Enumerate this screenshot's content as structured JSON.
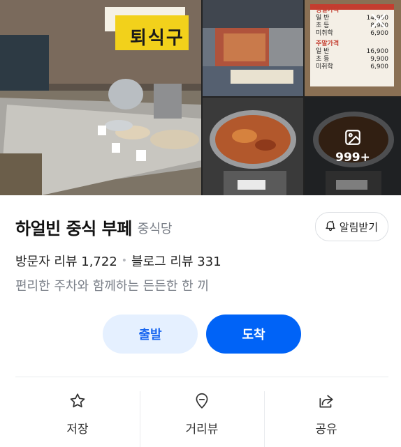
{
  "place": {
    "name": "하얼빈 중식 부페",
    "category": "중식당",
    "visitor_review_label": "방문자 리뷰 1,722",
    "blog_review_label": "블로그 리뷰 331",
    "description": "편리한 주차와 함께하는 든든한 한 끼"
  },
  "photos": {
    "main_sign_text": "퇴식구",
    "more_count": "999+",
    "price_board": {
      "weekday_title": "평일가격",
      "weekend_title": "주말가격",
      "rows_weekday": [
        {
          "label": "일 반",
          "price": "14,900"
        },
        {
          "label": "초 등",
          "price": "8,900"
        },
        {
          "label": "미취학",
          "price": "6,900"
        }
      ],
      "rows_weekend": [
        {
          "label": "일 반",
          "price": "16,900"
        },
        {
          "label": "초 등",
          "price": "9,900"
        },
        {
          "label": "미취학",
          "price": "6,900"
        }
      ]
    }
  },
  "buttons": {
    "alert": "알림받기",
    "depart": "출발",
    "arrive": "도착"
  },
  "tabs": [
    {
      "label": "저장",
      "icon": "star-icon"
    },
    {
      "label": "거리뷰",
      "icon": "map-pin-icon"
    },
    {
      "label": "공유",
      "icon": "share-icon"
    }
  ],
  "colors": {
    "primary": "#0063f7",
    "primary_light": "#e5f0ff",
    "muted_text": "#7b8089"
  }
}
